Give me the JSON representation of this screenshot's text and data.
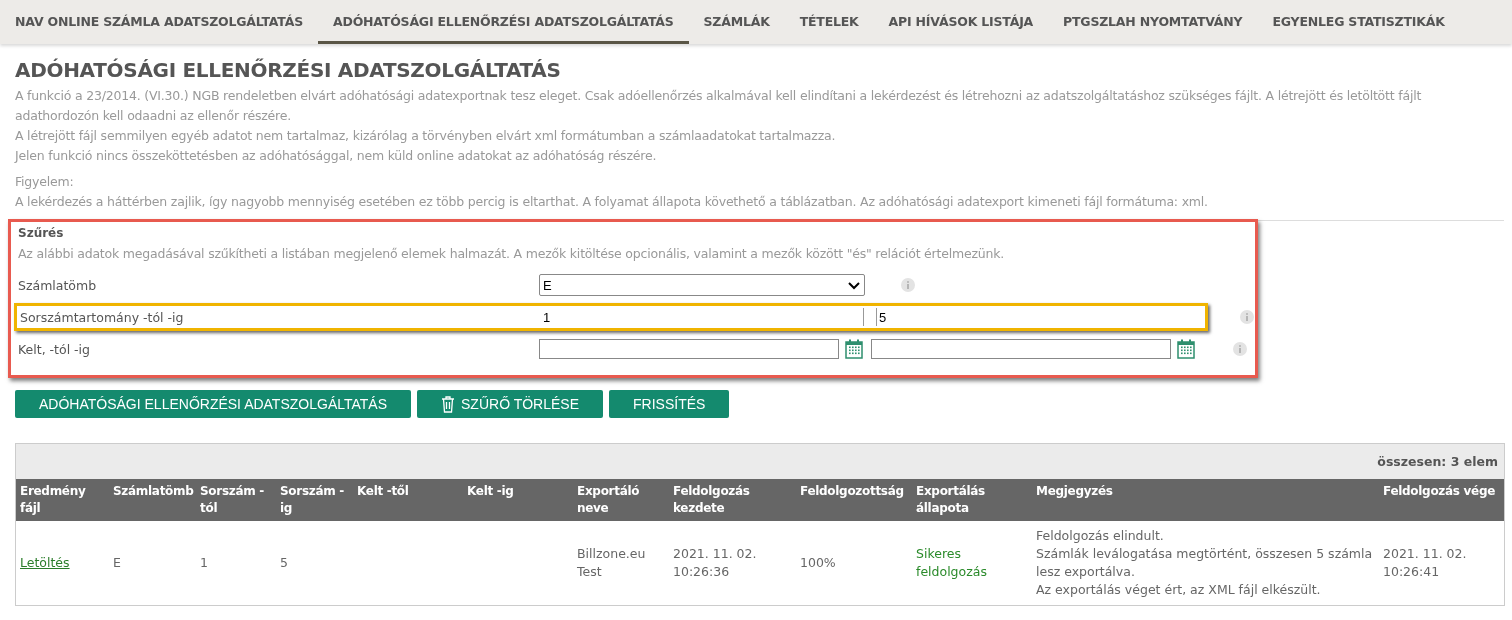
{
  "nav_tabs": [
    {
      "label": "NAV ONLINE SZÁMLA ADATSZOLGÁLTATÁS",
      "selected": false
    },
    {
      "label": "ADÓHATÓSÁGI ELLENŐRZÉSI ADATSZOLGÁLTATÁS",
      "selected": true
    },
    {
      "label": "SZÁMLÁK",
      "selected": false
    },
    {
      "label": "TÉTELEK",
      "selected": false
    },
    {
      "label": "API HÍVÁSOK LISTÁJA",
      "selected": false
    },
    {
      "label": "PTGSZLAH NYOMTATVÁNY",
      "selected": false
    },
    {
      "label": "EGYENLEG STATISZTIKÁK",
      "selected": false
    }
  ],
  "page_title": "ADÓHATÓSÁGI ELLENŐRZÉSI ADATSZOLGÁLTATÁS",
  "description": [
    "A funkció a 23/2014. (VI.30.) NGB rendeletben elvárt adóhatósági adatexportnak tesz eleget. Csak adóellenőrzés alkalmával kell elindítani a lekérdezést és létrehozni az adatszolgáltatáshoz szükséges fájlt. A létrejött és letöltött fájlt adathordozón kell odaadni az ellenőr részére.",
    "A létrejött fájl semmilyen egyéb adatot nem tartalmaz, kizárólag a törvényben elvárt xml formátumban a számlaadatokat tartalmazza.",
    "Jelen funkció nincs összeköttetésben az adóhatósággal, nem küld online adatokat az adóhatóság részére."
  ],
  "warning": {
    "title": "Figyelem:",
    "text": "A lekérdezés a háttérben zajlik, így nagyobb mennyiség esetében ez több percig is eltarthat. A folyamat állapota követhető a táblázatban. Az adóhatósági adatexport kimeneti fájl formátuma: xml."
  },
  "filter": {
    "title": "Szűrés",
    "hint": "Az alábbi adatok megadásával szűkítheti a listában megjelenő elemek halmazát. A mezők kitöltése opcionális, valamint a mezők között \"és\" relációt értelmezünk.",
    "rows": [
      {
        "kind": "select",
        "label": "Számlatömb",
        "value": "E",
        "highlighted": false
      },
      {
        "kind": "range",
        "label": "Sorszámtartomány -tól -ig",
        "from": "1",
        "to": "5",
        "highlighted": true
      },
      {
        "kind": "daterange",
        "label": "Kelt, -tól -ig",
        "highlighted": false
      }
    ]
  },
  "buttons": [
    {
      "kind": "plain",
      "label": "ADÓHATÓSÁGI ELLENŐRZÉSI ADATSZOLGÁLTATÁS"
    },
    {
      "kind": "trash",
      "label": "SZŰRŐ TÖRLÉSE"
    },
    {
      "kind": "plain",
      "label": "FRISSÍTÉS"
    }
  ],
  "table": {
    "total": "összesen: 3 elem",
    "columns": [
      "Eredmény fájl",
      "Számlatömb",
      "Sorszám -tól",
      "Sorszám -ig",
      "Kelt -től",
      "Kelt -ig",
      "Exportáló neve",
      "Feldolgozás kezdete",
      "Feldolgozottság",
      "Exportálás állapota",
      "Megjegyzés",
      "Feldolgozás vége"
    ],
    "rows": [
      {
        "cells": [
          {
            "kind": "link",
            "text": "Letöltés"
          },
          {
            "kind": "text",
            "text": "E"
          },
          {
            "kind": "text",
            "text": "1"
          },
          {
            "kind": "text",
            "text": "5"
          },
          {
            "kind": "text",
            "text": ""
          },
          {
            "kind": "text",
            "text": ""
          },
          {
            "kind": "text",
            "text": "Billzone.eu Test"
          },
          {
            "kind": "text",
            "text": "2021. 11. 02. 10:26:36"
          },
          {
            "kind": "text",
            "text": "100%"
          },
          {
            "kind": "status",
            "text": "Sikeres feldolgozás"
          },
          {
            "kind": "lines",
            "lines": [
              "Feldolgozás elindult.",
              "Számlák leválogatása megtörtént, összesen 5 számla lesz exportálva.",
              "Az exportálás véget ért, az XML fájl elkészült."
            ]
          },
          {
            "kind": "text",
            "text": "2021. 11. 02. 10:26:41"
          }
        ]
      }
    ]
  }
}
